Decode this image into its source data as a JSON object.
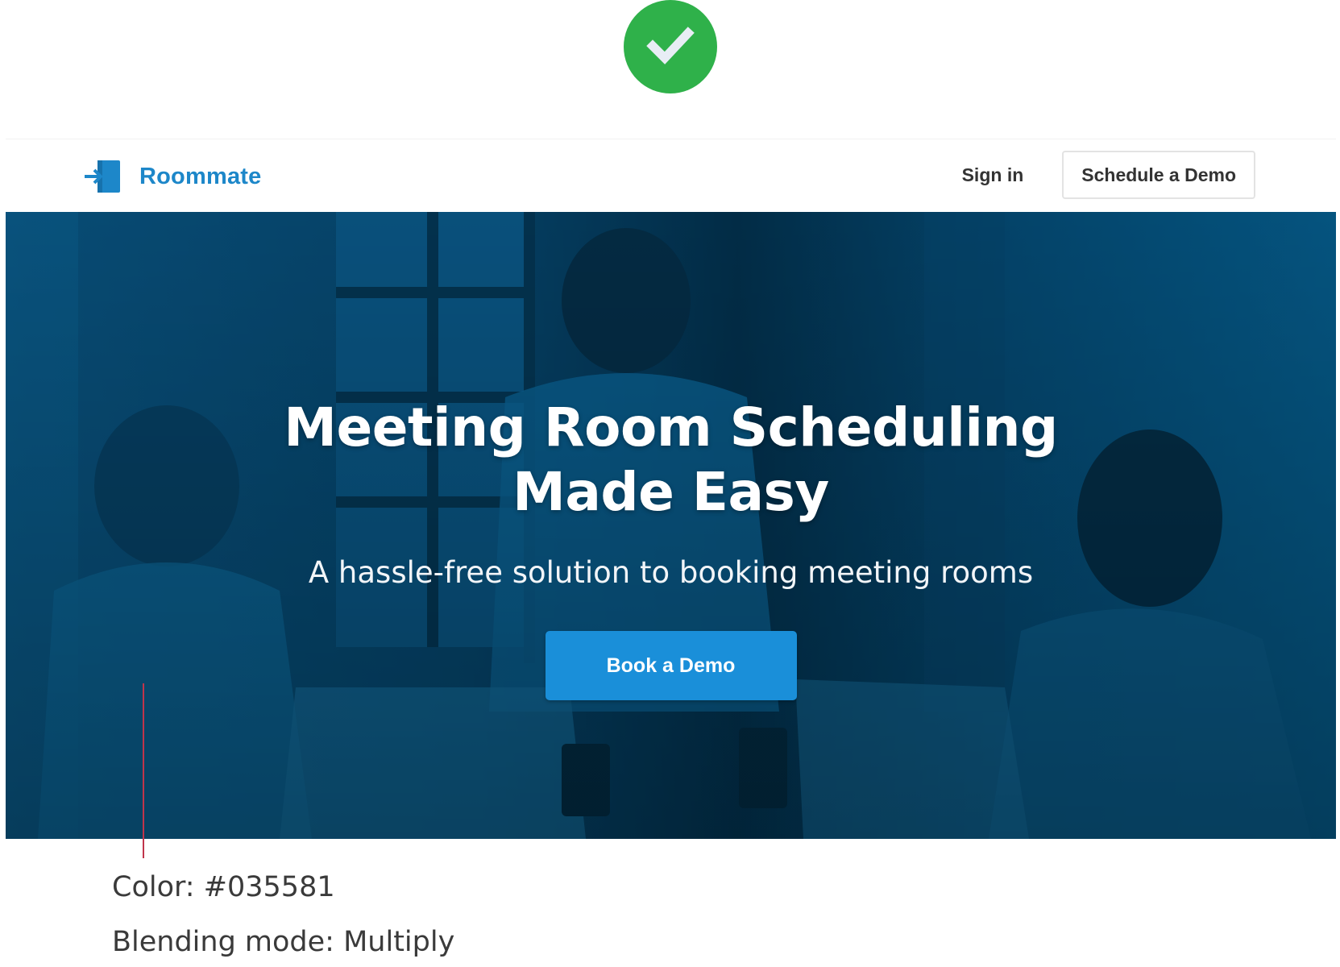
{
  "badge": {
    "icon": "check-icon",
    "color": "#2fb14a"
  },
  "navbar": {
    "brand_name": "Roommate",
    "brand_icon": "door-enter-icon",
    "brand_color": "#1d87c9",
    "sign_in_label": "Sign in",
    "schedule_demo_label": "Schedule a Demo"
  },
  "hero": {
    "title_line1": "Meeting Room Scheduling",
    "title_line2": "Made Easy",
    "subtitle": "A hassle-free solution to booking meeting rooms",
    "cta_label": "Book a Demo",
    "cta_color": "#1a8fd9",
    "overlay_color": "#035581"
  },
  "annotation": {
    "color_line": "Color: #035581",
    "blend_line": "Blending mode: Multiply",
    "pointer_color": "#c0354b"
  }
}
